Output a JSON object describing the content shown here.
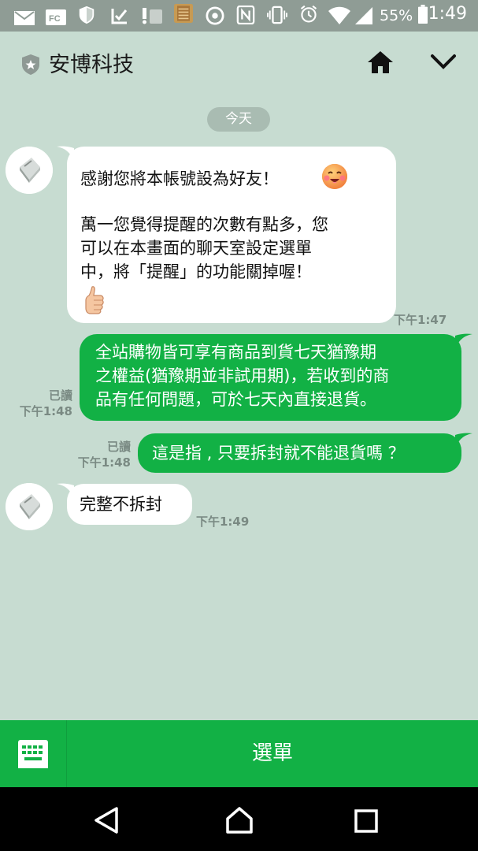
{
  "status_bar": {
    "battery": "55%",
    "time": "1:49"
  },
  "header": {
    "title": "安博科技"
  },
  "date_separator": "今天",
  "messages": [
    {
      "direction": "in",
      "lines": [
        "感謝您將本帳號設為好友！",
        "",
        "萬一您覺得提醒的次數有點多，您",
        "可以在本畫面的聊天室設定選單",
        "中，將「提醒」的功能關掉喔！"
      ],
      "time": "下午1:47"
    },
    {
      "direction": "out",
      "lines": [
        "全站購物皆可享有商品到貨七天猶豫期",
        "之權益(猶豫期並非試用期)，若收到的商",
        "品有任何問題，可於七天內直接退貨。"
      ],
      "read": "已讀",
      "time": "下午1:48"
    },
    {
      "direction": "out",
      "lines": [
        "這是指 , 只要拆封就不能退貨嗎 ？"
      ],
      "read": "已讀",
      "time": "下午1:48"
    },
    {
      "direction": "in",
      "lines": [
        "完整不拆封"
      ],
      "time": "下午1:49"
    }
  ],
  "bottom_bar": {
    "menu_label": "選單"
  },
  "colors": {
    "background": "#c7dcd1",
    "accent_green": "#12b145",
    "status_bar": "#8f9c95"
  }
}
